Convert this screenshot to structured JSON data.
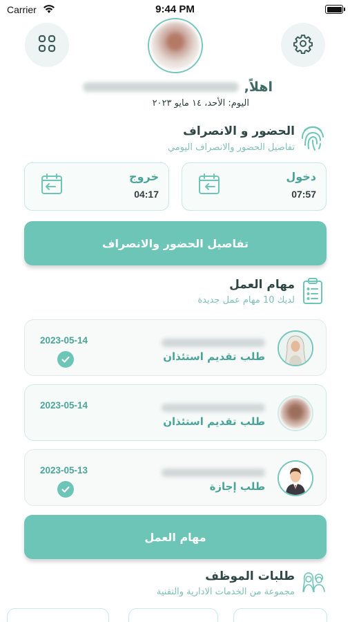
{
  "status_bar": {
    "carrier": "Carrier",
    "time": "9:44 PM"
  },
  "header": {
    "greeting": "اهلاً,",
    "date_line": "اليوم: الأحد، ١٤ مايو ٢٠٢٣"
  },
  "attendance": {
    "title": "الحضور و الانصراف",
    "subtitle": "تفاصيل الحضور والانصراف اليومي",
    "check_in": {
      "label": "دخول",
      "time": "07:57"
    },
    "check_out": {
      "label": "خروج",
      "time": "04:17"
    },
    "details_button": "تفاصيل الحضور والانصراف"
  },
  "tasks": {
    "title": "مهام العمل",
    "subtitle": "لديك 10 مهام عمل جديدة",
    "items": [
      {
        "type": "طلب تقديم استئذان",
        "date": "2023-05-14",
        "approved": true
      },
      {
        "type": "طلب تقديم استئذان",
        "date": "2023-05-14",
        "approved": false
      },
      {
        "type": "طلب إجازة",
        "date": "2023-05-13",
        "approved": true
      }
    ],
    "button": "مهام العمل"
  },
  "requests": {
    "title": "طلبات الموظف",
    "subtitle": "مجموعة من الخدمات الادارية والتقنية"
  },
  "colors": {
    "accent": "#6cc5b7",
    "accent_text": "#4aa598",
    "card_border": "#c8e8e3"
  },
  "icons": [
    "wifi-icon",
    "battery-icon",
    "grid-icon",
    "gear-icon",
    "fingerprint-icon",
    "calendar-in-icon",
    "calendar-out-icon",
    "clipboard-icon",
    "check-icon",
    "employees-icon"
  ]
}
